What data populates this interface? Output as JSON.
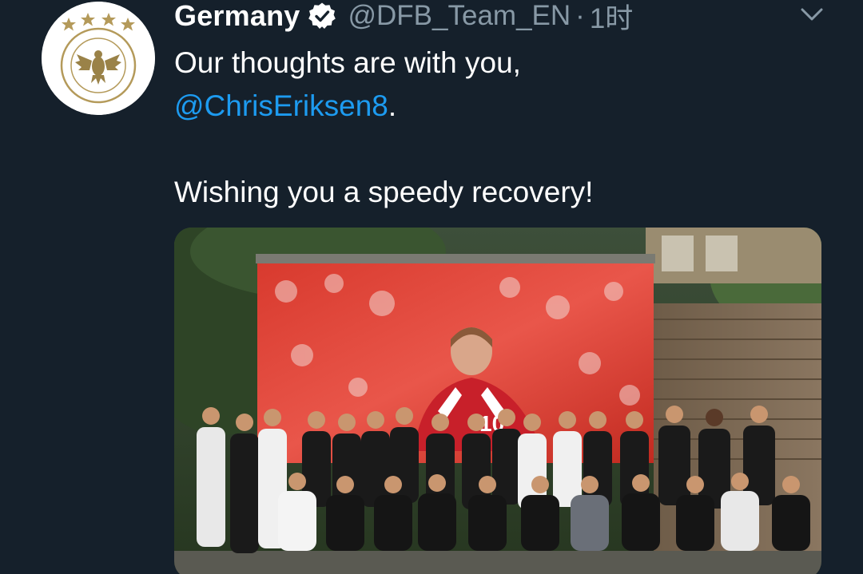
{
  "tweet": {
    "display_name": "Germany",
    "handle": "@DFB_Team_EN",
    "separator": "·",
    "time": "1时",
    "text_line1": "Our thoughts are with you,",
    "mention": "@ChrisEriksen8",
    "mention_suffix": ".",
    "text_line3": "Wishing you a speedy recovery!",
    "verified": true
  },
  "icons": {
    "avatar": "dfb-crest-icon",
    "verified": "verified-badge-icon",
    "menu": "chevron-down-icon"
  },
  "colors": {
    "background": "#15202b",
    "mention": "#1d9bf0",
    "secondary_text": "#8899a6"
  },
  "media": {
    "kind": "photo",
    "screen_number": "10"
  }
}
